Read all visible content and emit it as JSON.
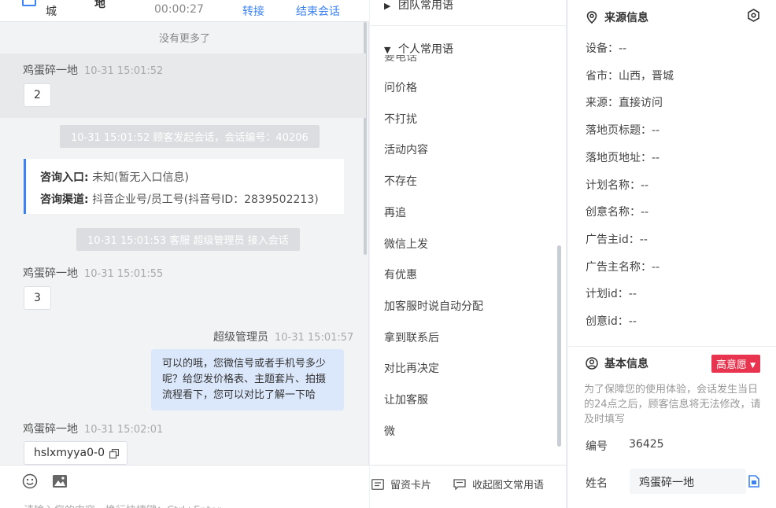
{
  "header": {
    "customer_name_part1": "城",
    "customer_name_part2": "地",
    "duration": "00:00:27",
    "transfer_label": "转接",
    "end_session_label": "结束会话"
  },
  "chat": {
    "no_more": "没有更多了",
    "msg1": {
      "sender": "鸡蛋碎一地",
      "time": "10-31 15:01:52",
      "text": "2"
    },
    "sys1": "10-31 15:01:52 顾客发起会话，会话编号：40206",
    "info_card": {
      "entry_label": "咨询入口:",
      "entry_value": "未知(暂无入口信息)",
      "channel_label": "咨询渠道:",
      "channel_value": "抖音企业号/员工号(抖音号ID：2839502213)"
    },
    "sys2": "10-31 15:01:53 客服 超级管理员 接入会话",
    "msg2": {
      "sender": "鸡蛋碎一地",
      "time": "10-31 15:01:55",
      "text": "3"
    },
    "msg3": {
      "sender": "超级管理员",
      "time": "10-31 15:01:57",
      "text": "可以的哦，您微信号或者手机号多少呢？给您发价格表、主题套片、拍摄流程看下，您可以对比了解一下哈"
    },
    "msg4": {
      "sender": "鸡蛋碎一地",
      "time": "10-31 15:02:01",
      "text": "hslxmyya0-0"
    },
    "input_placeholder": "请输入您的内容，换行快捷键：Ctrl+Enter"
  },
  "phrases": {
    "team_group": "团队常用语",
    "personal_group": "个人常用语",
    "partial_item": "要电话",
    "items": [
      "问价格",
      "不打扰",
      "活动内容",
      "不存在",
      "再追",
      "微信上发",
      "有优惠",
      "加客服时说自动分配",
      "拿到联系后",
      "对比再决定",
      "让加客服",
      "微"
    ],
    "leave_card": "留资卡片",
    "collapse": "收起图文常用语"
  },
  "source_info": {
    "title": "来源信息",
    "fields": [
      "设备：--",
      "省市：山西，晋城",
      "来源：直接访问",
      "落地页标题：--",
      "落地页地址：--",
      "计划名称：--",
      "创意名称：--",
      "广告主id：--",
      "广告主名称：--",
      "计划id：--",
      "创意id：--"
    ]
  },
  "basic_info": {
    "title": "基本信息",
    "intent_badge": "高意愿",
    "note": "为了保障您的使用体验，会话发生当日的24点之后，顾客信息将无法修改，请及时填写",
    "id_label": "编号",
    "id_value": "36425",
    "name_label": "姓名",
    "name_value": "鸡蛋碎一地"
  },
  "colors": {
    "accent": "#3b82f6",
    "badge": "#e8344e",
    "agent_bubble": "#dbe8fc"
  }
}
